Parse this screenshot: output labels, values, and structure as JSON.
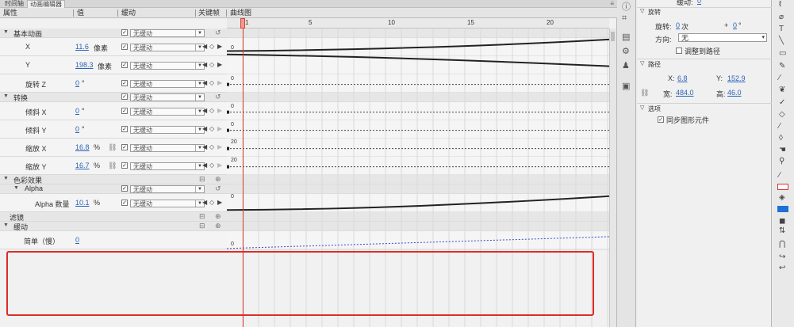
{
  "tabs": [
    {
      "label": "时间轴"
    },
    {
      "label": "动画编辑器"
    }
  ],
  "columns": {
    "property": "属性",
    "value": "值",
    "ease": "缓动",
    "keyframe": "关键帧",
    "graph": "曲线图"
  },
  "ruler": {
    "ticks": [
      "1",
      "5",
      "10",
      "15",
      "20"
    ]
  },
  "ease_dropdown_default": "无缓动",
  "rows": [
    {
      "kind": "group",
      "label": "基本动画",
      "has_ease": true
    },
    {
      "kind": "prop",
      "label": "X",
      "value": "11.6",
      "unit": "像素",
      "has_ease": true
    },
    {
      "kind": "prop",
      "label": "Y",
      "value": "198.3",
      "unit": "像素",
      "has_ease": true
    },
    {
      "kind": "prop",
      "label": "旋转 Z",
      "value": "0",
      "unit": "°",
      "has_ease": true
    },
    {
      "kind": "group",
      "label": "转换",
      "has_ease": true
    },
    {
      "kind": "prop",
      "label": "倾斜 X",
      "value": "0",
      "unit": "°",
      "has_ease": true
    },
    {
      "kind": "prop",
      "label": "倾斜 Y",
      "value": "0",
      "unit": "°",
      "has_ease": true
    },
    {
      "kind": "prop",
      "label": "缩放 X",
      "value": "16.8",
      "unit": "%",
      "has_ease": true
    },
    {
      "kind": "prop",
      "label": "缩放 Y",
      "value": "16.7",
      "unit": "%",
      "has_ease": true
    },
    {
      "kind": "group",
      "label": "色彩效果",
      "has_ease": false
    },
    {
      "kind": "group2",
      "label": "Alpha",
      "has_ease": true
    },
    {
      "kind": "prop",
      "label": "Alpha 数量",
      "value": "10.1",
      "unit": "%",
      "has_ease": true
    },
    {
      "kind": "group",
      "label": "滤镜",
      "has_ease": false
    },
    {
      "kind": "group",
      "label": "缓动",
      "has_ease": false
    },
    {
      "kind": "prop",
      "label": "简单（慢）",
      "value": "0",
      "unit": "",
      "has_ease": false
    }
  ],
  "graph_labels": {
    "x": "0",
    "rotz": "0",
    "skewx": "0",
    "skewy": "0",
    "scalex": "20",
    "scaley": "20",
    "alpha": "0",
    "ease": "0"
  },
  "props_panel": {
    "easing_label": "缓动:",
    "easing_value": "0",
    "rotation_section": "旋转",
    "rotate_label": "旋转:",
    "rotate_times": "0",
    "rotate_times_unit": "次",
    "rotate_plus": "+",
    "rotate_degrees": "0",
    "rotate_degrees_unit": "°",
    "direction_label": "方向:",
    "direction_value": "无",
    "orient_to_path": "调整到路径",
    "path_section": "路径",
    "x_label": "X:",
    "x_value": "6.8",
    "y_label": "Y:",
    "y_value": "152.9",
    "w_label": "宽:",
    "w_value": "484.0",
    "h_label": "高:",
    "h_value": "46.0",
    "options_section": "选项",
    "sync_symbols": "同步图形元件"
  },
  "colors": {
    "accent_red": "#e02b26",
    "link_blue": "#2b63b8",
    "curve": "#222222",
    "ease_line": "#3a4cc9"
  }
}
